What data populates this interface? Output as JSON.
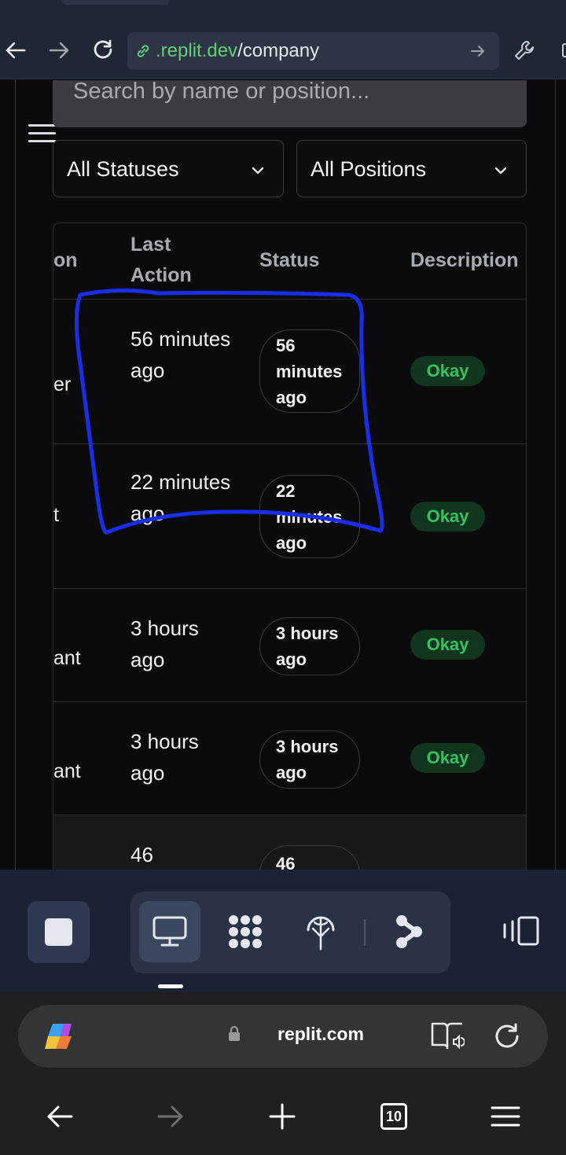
{
  "browser_top": {
    "url_domain": ".replit.dev",
    "url_path": "/company"
  },
  "search": {
    "placeholder": "Search by name or position..."
  },
  "filters": {
    "status": "All Statuses",
    "position": "All Positions"
  },
  "table": {
    "headers": {
      "position": "on",
      "last_action": "Last Action",
      "status": "Status",
      "description": "Description"
    },
    "rows": [
      {
        "position": "er",
        "last_action": "56 minutes ago",
        "status": "56 minutes ago",
        "description": "Okay"
      },
      {
        "position": "t",
        "last_action": "22 minutes ago",
        "status": "22 minutes ago",
        "description": "Okay"
      },
      {
        "position": "ant",
        "last_action": "3 hours ago",
        "status": "3 hours ago",
        "description": "Okay"
      },
      {
        "position": "ant",
        "last_action": "3 hours ago",
        "status": "3 hours ago",
        "description": "Okay"
      },
      {
        "position": "",
        "last_action": "46",
        "status": "46",
        "description": ""
      }
    ]
  },
  "browser_bottom": {
    "address": "replit.com",
    "tab_count": "10"
  },
  "icons": {
    "back": "arrow-left-icon",
    "forward": "arrow-right-icon",
    "reload": "reload-icon",
    "site": "link-icon",
    "go": "go-arrow-icon",
    "devtools": "wrench-icon",
    "stop": "stop-icon",
    "desktop": "desktop-icon",
    "apps": "apps-icon",
    "network": "network-icon",
    "share": "share-icon",
    "panel": "panel-icon",
    "copilot": "copilot-icon",
    "lock": "lock-icon",
    "read_aloud": "read-aloud-icon",
    "refresh": "refresh-icon",
    "new_tab": "plus-icon",
    "menu": "menu-icon"
  },
  "colors": {
    "url_domain": "#5fcf7a",
    "okay_badge_bg": "#12351e",
    "okay_badge_text": "#35c262",
    "annotation": "#1a2ee8"
  }
}
